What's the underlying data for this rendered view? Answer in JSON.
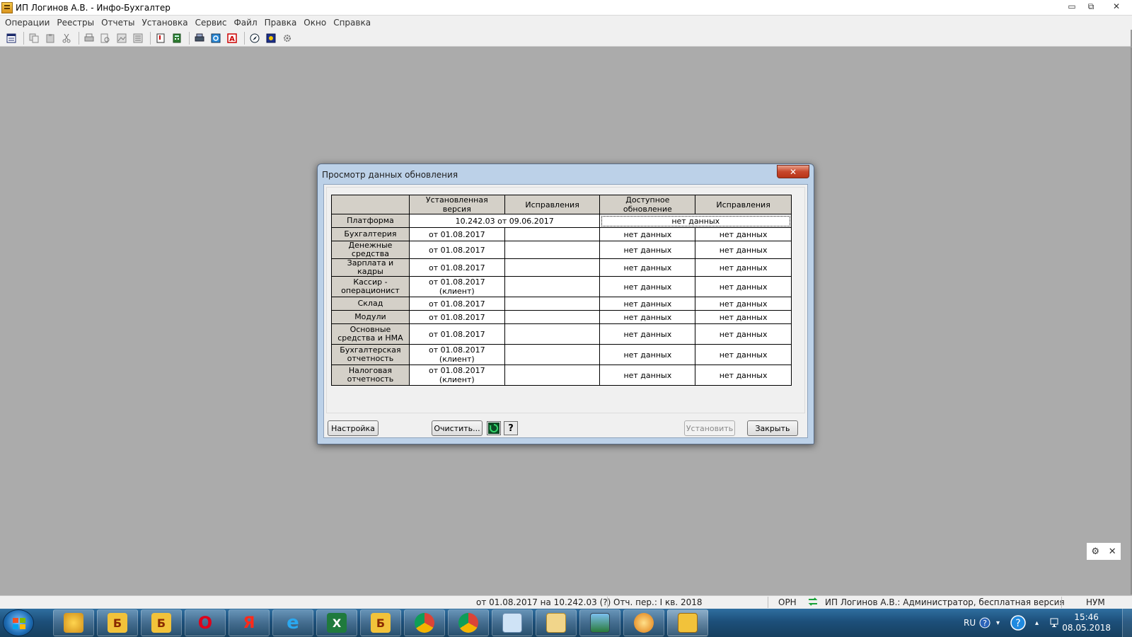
{
  "window": {
    "title": "ИП Логинов А.В. - Инфо-Бухгалтер",
    "minimize_glyph": "▭",
    "restore_glyph": "⧉",
    "close_glyph": "✕"
  },
  "menu": [
    "Операции",
    "Реестры",
    "Отчеты",
    "Установка",
    "Сервис",
    "Файл",
    "Правка",
    "Окно",
    "Справка"
  ],
  "toolbar": {
    "icons": [
      "journal-icon",
      "copy-icon",
      "paste-icon",
      "cut-icon",
      "print-icon",
      "print-preview-icon",
      "image-icon",
      "export-icon",
      "document-number-icon",
      "calculator-icon",
      "printer-setup-icon",
      "refresh-icon",
      "font-a-icon",
      "compass-icon",
      "archive-icon",
      "settings-cog-icon"
    ]
  },
  "dialog": {
    "title": "Просмотр данных обновления",
    "close_glyph": "✕",
    "columns": [
      "",
      "Установленная версия",
      "Исправления",
      "Доступное обновление",
      "Исправления"
    ],
    "platform_row": {
      "name": "Платформа",
      "installed": "10.242.03 от 09.06.2017",
      "available": "нет данных"
    },
    "rows": [
      {
        "name": "Бухгалтерия",
        "installed": "от 01.08.2017",
        "fixes": "",
        "available": "нет данных",
        "available_fixes": "нет данных"
      },
      {
        "name": "Денежные средства",
        "installed": "от 01.08.2017",
        "fixes": "",
        "available": "нет данных",
        "available_fixes": "нет данных"
      },
      {
        "name": "Зарплата и кадры",
        "installed": "от 01.08.2017",
        "fixes": "",
        "available": "нет данных",
        "available_fixes": "нет данных"
      },
      {
        "name": "Кассир - операционист",
        "installed": "от 01.08.2017 (клиент)",
        "fixes": "",
        "available": "нет данных",
        "available_fixes": "нет данных"
      },
      {
        "name": "Склад",
        "installed": "от 01.08.2017",
        "fixes": "",
        "available": "нет данных",
        "available_fixes": "нет данных"
      },
      {
        "name": "Модули",
        "installed": "от 01.08.2017",
        "fixes": "",
        "available": "нет данных",
        "available_fixes": "нет данных"
      },
      {
        "name": "Основные средства и НМА",
        "installed": "от 01.08.2017",
        "fixes": "",
        "available": "нет данных",
        "available_fixes": "нет данных"
      },
      {
        "name": "Бухгалтерская отчетность",
        "installed": "от 01.08.2017 (клиент)",
        "fixes": "",
        "available": "нет данных",
        "available_fixes": "нет данных"
      },
      {
        "name": "Налоговая отчетность",
        "installed": "от 01.08.2017 (клиент)",
        "fixes": "",
        "available": "нет данных",
        "available_fixes": "нет данных"
      }
    ],
    "buttons": {
      "settings": "Настройка",
      "clear": "Очистить...",
      "help_glyph": "?",
      "install": "Установить",
      "close": "Закрыть"
    }
  },
  "floating_widget": {
    "gear": "⚙",
    "close": "✕"
  },
  "statusbar": {
    "version": "от 01.08.2017 на 10.242.03 (?)",
    "period": "Отч. пер.: I кв. 2018",
    "mode": "ОРН",
    "user": "ИП Логинов А.В.: Администратор, бесплатная версия",
    "num": "НУМ"
  },
  "taskbar": {
    "apps": [
      {
        "name": "paint-app",
        "label": ""
      },
      {
        "name": "buh-2018-app",
        "label": "Б"
      },
      {
        "name": "buh-2016-app",
        "label": "Б"
      },
      {
        "name": "opera-app",
        "label": "O"
      },
      {
        "name": "yandex-app",
        "label": "Я"
      },
      {
        "name": "ie-app",
        "label": "e"
      },
      {
        "name": "excel-app",
        "label": "X"
      },
      {
        "name": "buh-2011-app",
        "label": "Б"
      },
      {
        "name": "chrome-app",
        "label": ""
      },
      {
        "name": "chrome-user-app",
        "label": ""
      },
      {
        "name": "remote-desktop-app",
        "label": ""
      },
      {
        "name": "explorer-app",
        "label": ""
      },
      {
        "name": "photo-viewer-app",
        "label": ""
      },
      {
        "name": "game-app",
        "label": ""
      },
      {
        "name": "infobuh-active-app",
        "label": ""
      }
    ],
    "lang": "RU",
    "time": "15:46",
    "date": "08.05.2018"
  },
  "colors": {
    "accent_close": "#c7472c",
    "workspace": "#ababab",
    "taskbar": "#1d4f7a",
    "refresh_green": "#1a9b3a"
  }
}
